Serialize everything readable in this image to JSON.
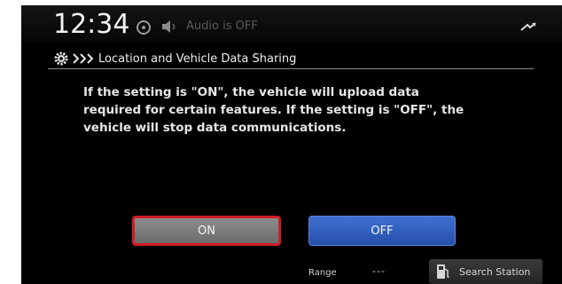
{
  "status_bar": {
    "time": "12:34",
    "audio_status": "Audio is OFF",
    "icons": [
      "audio-source-icon",
      "speaker-icon",
      "connection-icon"
    ]
  },
  "header": {
    "title": "Location and Vehicle Data Sharing",
    "icons": [
      "gear-icon",
      "chevrons-icon"
    ]
  },
  "message": "If the setting is \"ON\", the vehicle will upload data\nrequired for certain features.  If the setting is \"OFF\", the\nvehicle will stop data communications.",
  "buttons": {
    "on_label": "ON",
    "off_label": "OFF"
  },
  "footer": {
    "range_label": "Range",
    "range_value": "---",
    "search_station_label": "Search Station",
    "search_station_icon": "fuel-pump-icon"
  },
  "colors": {
    "selected_border": "#d11c24",
    "off_button": "#2f5fc0",
    "on_button": "#7a7a7a"
  }
}
